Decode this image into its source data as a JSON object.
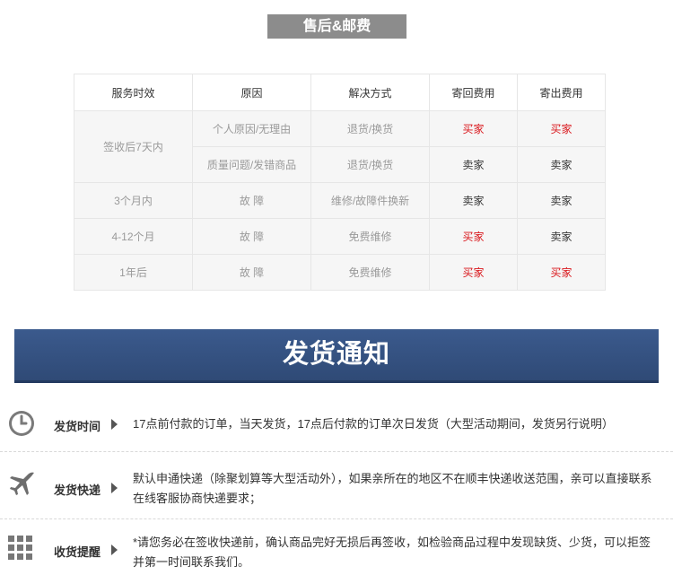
{
  "after_sales": {
    "title": "售后&邮费",
    "headers": [
      "服务时效",
      "原因",
      "解决方式",
      "寄回费用",
      "寄出费用"
    ],
    "rows": [
      {
        "period": "签收后7天内",
        "reason": "个人原因/无理由",
        "solution": "退货/换货",
        "return_fee": "买家",
        "send_fee": "买家"
      },
      {
        "reason": "质量问题/发错商品",
        "solution": "退货/换货",
        "return_fee": "卖家",
        "send_fee": "卖家"
      },
      {
        "period": "3个月内",
        "reason": "故 障",
        "solution": "维修/故障件换新",
        "return_fee": "卖家",
        "send_fee": "卖家"
      },
      {
        "period": "4-12个月",
        "reason": "故 障",
        "solution": "免费维修",
        "return_fee": "买家",
        "send_fee": "卖家"
      },
      {
        "period": "1年后",
        "reason": "故 障",
        "solution": "免费维修",
        "return_fee": "买家",
        "send_fee": "买家"
      }
    ]
  },
  "shipping": {
    "title": "发货通知",
    "items": [
      {
        "icon": "clock-icon",
        "label": "发货时间",
        "text": "17点前付款的订单，当天发货，17点后付款的订单次日发货（大型活动期间，发货另行说明）"
      },
      {
        "icon": "airplane-icon",
        "label": "发货快递",
        "text": "默认申通快递（除聚划算等大型活动外），如果亲所在的地区不在顺丰快递收送范围，亲可以直接联系在线客服协商快递要求；"
      },
      {
        "icon": "grid-icon",
        "label": "收货提醒",
        "text": "*请您务必在签收快递前，确认商品完好无损后再签收，如检验商品过程中发现缺货、少货，可以拒签并第一时间联系我们。"
      }
    ]
  },
  "colors": {
    "buyer": "#d9151a",
    "seller": "#333333",
    "banner": "#34507f"
  }
}
